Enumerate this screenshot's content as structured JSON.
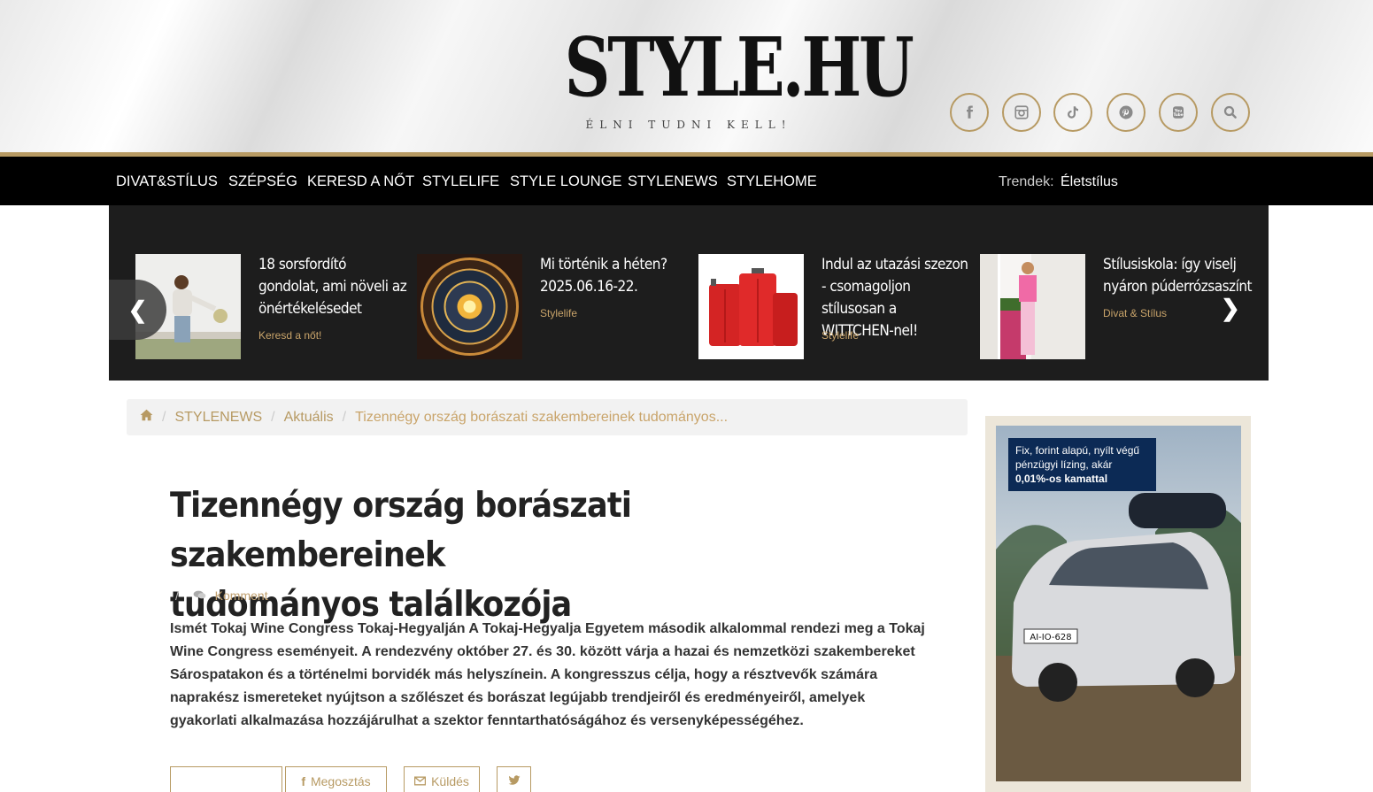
{
  "header": {
    "logo_main": "STYLE.HU",
    "logo_sub": "ÉLNI TUDNI KELL!",
    "social": [
      "facebook-icon",
      "instagram-icon",
      "tiktok-icon",
      "pinterest-icon",
      "youtube-icon",
      "search-icon"
    ]
  },
  "nav": {
    "items": [
      "DIVAT&STÍLUS",
      "SZÉPSÉG",
      "KERESD A NŐT",
      "STYLELIFE",
      "STYLE LOUNGE",
      "STYLENEWS",
      "STYLEHOME"
    ],
    "trends_label": "Trendek:",
    "trends_value": "Életstílus"
  },
  "carousel": {
    "cards": [
      {
        "title": "18 sorsfordító gondolat, ami növeli az önértékelésedet",
        "category": "Keresd a nőt!"
      },
      {
        "title": "Mi történik a héten? 2025.06.16-22.",
        "category": "Stylelife"
      },
      {
        "title": "Indul az utazási szezon - csomagoljon stílusosan a WITTCHEN-nel!",
        "category": "Stylelife"
      },
      {
        "title": "Stílusiskola: így viselj nyáron púderrózsaszínt",
        "category": "Divat & Stílus"
      }
    ]
  },
  "breadcrumb": {
    "items": [
      "STYLENEWS",
      "Aktuális",
      "Tizennégy ország borászati szakembereinek tudományos..."
    ]
  },
  "article": {
    "title_line1": "Tizennégy ország borászati szakembereinek",
    "title_line2": "tudományos találkozója",
    "meta_comment": "Komment",
    "lead": "Ismét Tokaj Wine Congress Tokaj-Hegyalján A Tokaj-Hegyalja Egyetem második alkalommal rendezi meg a Tokaj Wine Congress eseményeit. A rendezvény október 27. és 30. között várja a hazai és nemzetközi szakembereket Sárospatakon és a történelmi borvidék más helyszínein. A kongresszus célja, hogy a résztvevők számára naprakész ismereteket nyújtson a szőlészet és borászat legújabb trendjeiről és eredményeiről, amelyek gyakorlati alkalmazása hozzájárulhat a szektor fenntarthatóságához és versenyképességéhez.",
    "share_label": "Megosztás",
    "send_label": "Küldés"
  },
  "ad": {
    "line1": "Fix, forint alapú, nyílt végű",
    "line2": "pénzügyi lízing, akár",
    "line3": "0,01%-os kamattal",
    "plate": "AI-IO-628"
  }
}
